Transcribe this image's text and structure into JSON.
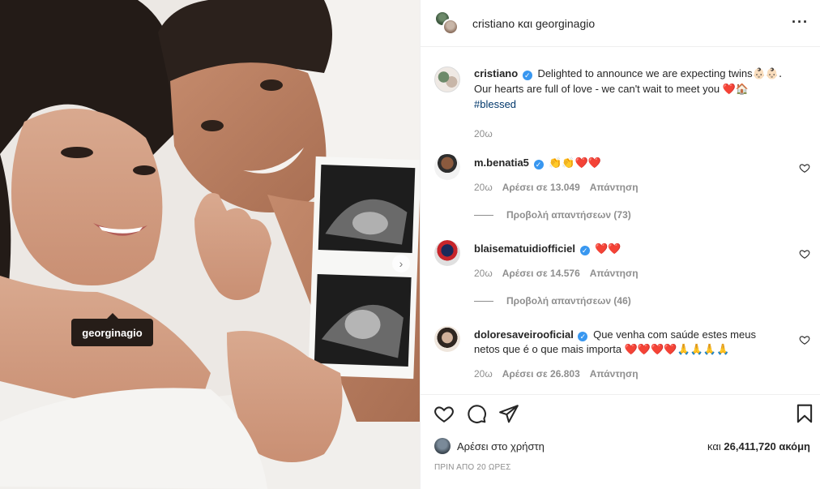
{
  "photo": {
    "tag_label": "georginagio",
    "next_icon": "chevron-right-icon"
  },
  "header": {
    "user1": "cristiano",
    "joiner": "και",
    "user2": "georginagio",
    "more_icon": "more-dots-icon"
  },
  "caption": {
    "username": "cristiano",
    "text": "Delighted to announce we are expecting twins",
    "emoji_after_text": "👶🏻👶🏻.",
    "text2": "Our hearts are full of love - we can't wait to meet you",
    "emoji_end": "❤️🏠",
    "hashtag": "#blessed",
    "time": "20ω"
  },
  "comments": [
    {
      "username": "m.benatia5",
      "verified": true,
      "text": "👏👏❤️❤️",
      "time": "20ω",
      "likes": "Αρέσει σε 13.049",
      "reply": "Απάντηση",
      "view_replies": "Προβολή απαντήσεων (73)"
    },
    {
      "username": "blaisematuidiofficiel",
      "verified": true,
      "text": "❤️❤️",
      "time": "20ω",
      "likes": "Αρέσει σε 14.576",
      "reply": "Απάντηση",
      "view_replies": "Προβολή απαντήσεων (46)"
    },
    {
      "username": "doloresaveirooficial",
      "verified": true,
      "text": "Que venha com saúde estes meus",
      "text2": "netos que é o que mais importa",
      "emoji2": "❤️❤️❤️❤️🙏🙏🙏🙏",
      "time": "20ω",
      "likes": "Αρέσει σε 26.803",
      "reply": "Απάντηση"
    }
  ],
  "actions": {
    "like_icon": "heart-icon",
    "comment_icon": "comment-icon",
    "share_icon": "share-icon",
    "save_icon": "bookmark-icon"
  },
  "likes_row": {
    "liked_by": "Αρέσει στο χρήστη",
    "and_label": "και",
    "count": "26,411,720 ακόμη"
  },
  "time_ago": "ΠΡΙΝ ΑΠΟ 20 ΩΡΕΣ",
  "colors": {
    "verified": "#3897f0",
    "link": "#00376b",
    "muted": "#8e8e8e"
  }
}
